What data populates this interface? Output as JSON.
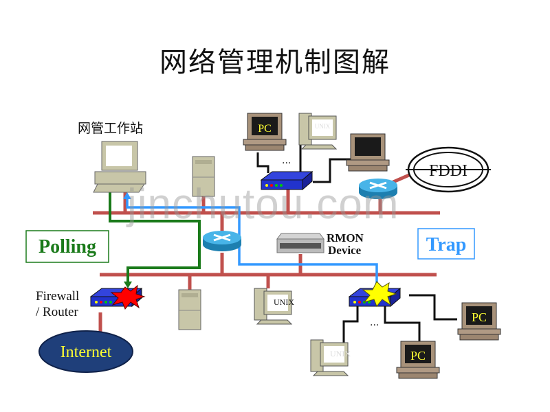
{
  "title": "网络管理机制图解",
  "labels": {
    "nms_station": "网管工作站",
    "polling": "Polling",
    "trap": "Trap",
    "rmon_line1": "RMON",
    "rmon_line2": "Device",
    "firewall_line1": "Firewall",
    "firewall_line2": "/ Router",
    "internet": "Internet",
    "fddi": "FDDI",
    "pc": "PC",
    "unix": "UNIX",
    "ellipsis": "..."
  },
  "watermark": "jinchutou.com",
  "colors": {
    "lan_bus": "#c0504d",
    "polling_path": "#1a7a1a",
    "trap_path": "#3399ff",
    "switch_body": "#2233cc",
    "router_body": "#2a9fd6",
    "internet_cloud": "#1f3f7a",
    "internet_text": "#ffff33",
    "alert_red": "#ff0000",
    "alert_yellow": "#ffff00"
  }
}
